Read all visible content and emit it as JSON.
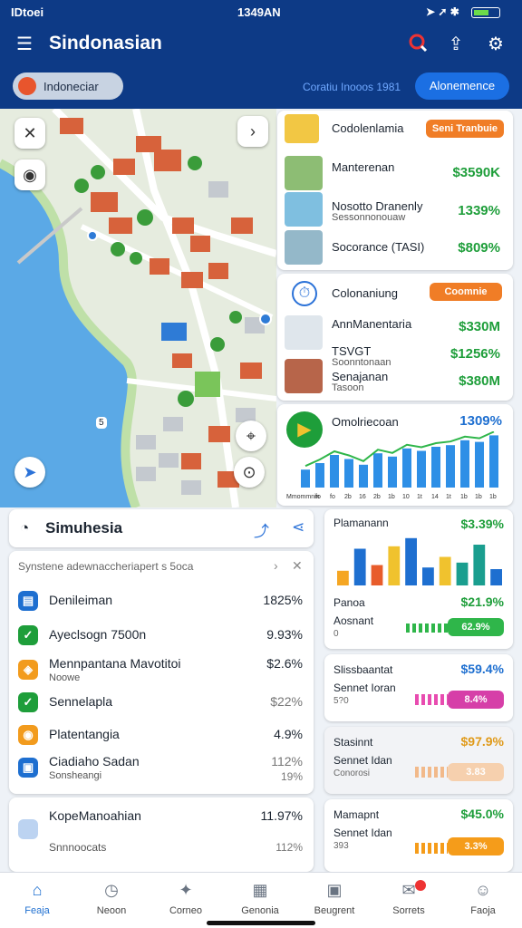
{
  "status": {
    "carrier": "IDtoei",
    "time": "1349AN"
  },
  "header": {
    "title": "Sindonasian"
  },
  "subbar": {
    "region": "Indoneciar",
    "caption": "Coratiu Inooos 1981",
    "action": "Alonemence"
  },
  "map": {
    "route_label": "5"
  },
  "cards": {
    "top": {
      "title": "Codolenlamia",
      "badge": "Seni Tranbuie",
      "items": [
        {
          "name": "Manterenan",
          "value": "$3590K"
        },
        {
          "name": "Nosotto Dranenly",
          "sub": "Sessonnonouaw",
          "value": "1339%"
        },
        {
          "name": "Socorance (TASI)",
          "value": "$809%"
        }
      ]
    },
    "mid": {
      "title": "Colonaniung",
      "badge": "Coomnie",
      "items": [
        {
          "name": "AnnManentaria",
          "value": "$330M"
        },
        {
          "name": "TSVGT",
          "sub": "Soonntonaan",
          "value": "$1256%"
        },
        {
          "name": "Senajanan",
          "sub": "Tasoon",
          "value": "$380M"
        }
      ]
    },
    "chart": {
      "title": "Omolriecoan",
      "value": "1309%",
      "categories": [
        "Mmommnin",
        "fo",
        "fo",
        "2b",
        "16",
        "2b",
        "1b",
        "10",
        "1t",
        "14",
        "1t",
        "1b",
        "1b",
        "1b"
      ]
    }
  },
  "panel": {
    "title": "Simuhesia",
    "subtitle": "Synstene adewnaccheriapert s 5oca",
    "rows": [
      {
        "label": "Denileiman",
        "value": "1825%"
      },
      {
        "label": "Ayeclsogn 7500n",
        "value": "9.93%"
      },
      {
        "label": "Mennpantana Mavotitoi",
        "sub": "Noowe",
        "value": "$2.6%"
      },
      {
        "label": "Sennelapla",
        "value": "$22%"
      },
      {
        "label": "Platentangia",
        "value": "4.9%"
      },
      {
        "label": "Ciadiaho Sadan",
        "sub": "Sonsheangi",
        "value": "112%",
        "value2": "19%"
      }
    ],
    "bottom": {
      "label": "KopeManoahian",
      "sub": "Snnnoocats",
      "value": "11.97%",
      "value2": "112%"
    }
  },
  "mini": {
    "a": {
      "title": "Plamanann",
      "value": "$3.39%",
      "label1": "Panoa",
      "label1v": "$21.9%",
      "label2": "Aosnant",
      "label2sub": "0",
      "bar": "62.9%",
      "series": [
        {
          "v": 18,
          "c": "#f5a623"
        },
        {
          "v": 45,
          "c": "#1e6fd0"
        },
        {
          "v": 25,
          "c": "#e85c2b"
        },
        {
          "v": 48,
          "c": "#f0c22e"
        },
        {
          "v": 58,
          "c": "#1e6fd0"
        },
        {
          "v": 22,
          "c": "#1e6fd0"
        },
        {
          "v": 35,
          "c": "#f0c22e"
        },
        {
          "v": 28,
          "c": "#1a9e8f"
        },
        {
          "v": 50,
          "c": "#1a9e8f"
        },
        {
          "v": 20,
          "c": "#1e6fd0"
        }
      ]
    },
    "b": {
      "title": "Slissbaantat",
      "value": "$59.4%",
      "label": "Sennet Ioran",
      "sub": "5?0",
      "bar": "8.4%"
    },
    "c": {
      "title": "Stasinnt",
      "value": "$97.9%",
      "label": "Sennet Idan",
      "sub": "Conorosi",
      "bar": "3.83"
    },
    "d": {
      "title": "Mamapnt",
      "value": "$45.0%",
      "label": "Sennet Idan",
      "sub": "393",
      "bar": "3.3%"
    }
  },
  "nav": [
    {
      "label": "Feaja",
      "icon": "home-icon"
    },
    {
      "label": "Neoon",
      "icon": "clock-icon"
    },
    {
      "label": "Corneo",
      "icon": "star-icon"
    },
    {
      "label": "Genonia",
      "icon": "calculator-icon"
    },
    {
      "label": "Beugrent",
      "icon": "briefcase-icon"
    },
    {
      "label": "Sorrets",
      "icon": "chat-icon"
    },
    {
      "label": "Faoja",
      "icon": "person-icon"
    }
  ]
}
